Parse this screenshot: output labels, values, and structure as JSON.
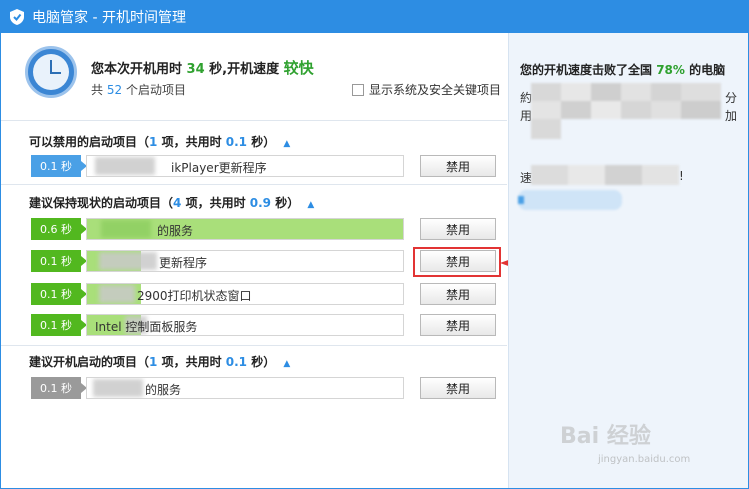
{
  "window": {
    "title": "电脑管家 - 开机时间管理"
  },
  "summary": {
    "line1_prefix": "您本次开机用时",
    "seconds": "34",
    "line1_mid": "秒,开机速度",
    "speed_word": "较快",
    "line2_prefix": "共",
    "item_count": "52",
    "line2_suffix": "个启动项目",
    "checkbox_label": "显示系统及安全关键项目"
  },
  "sections": {
    "can_disable": {
      "title": "可以禁用的启动项目（",
      "count": "1",
      "mid": "项，共用时",
      "time": "0.1",
      "suffix": "秒）"
    },
    "keep": {
      "title": "建议保持现状的启动项目（",
      "count": "4",
      "mid": "项，共用时",
      "time": "0.9",
      "suffix": "秒）"
    },
    "recommend": {
      "title": "建议开机启动的项目（",
      "count": "1",
      "mid": "项，共用时",
      "time": "0.1",
      "suffix": "秒）"
    }
  },
  "rows": [
    {
      "time": "0.1 秒",
      "name": "ikPlayer更新程序",
      "button": "禁用",
      "badge_color": "#4aa0e6",
      "bar_fraction": 0
    },
    {
      "time": "0.6 秒",
      "name": "的服务",
      "button": "禁用",
      "badge_color": "#52b81f",
      "bar_fraction": 1.0
    },
    {
      "time": "0.1 秒",
      "name": "更新程序",
      "button": "禁用",
      "badge_color": "#52b81f",
      "bar_fraction": 0.17
    },
    {
      "time": "0.1 秒",
      "name": "2900打印机状态窗口",
      "button": "禁用",
      "badge_color": "#52b81f",
      "bar_fraction": 0.17
    },
    {
      "time": "0.1 秒",
      "name": "Intel    控制面板服务",
      "button": "禁用",
      "badge_color": "#52b81f",
      "bar_fraction": 0.17
    },
    {
      "time": "0.1 秒",
      "name": "的服务",
      "button": "禁用",
      "badge_color": "#9a9a9a",
      "bar_fraction": 0
    }
  ],
  "right_panel": {
    "title_prefix": "您的开机速度击败了全国",
    "percent": "78%",
    "title_suffix": "的电脑",
    "frag_1": "約",
    "frag_2": "分",
    "frag_3": "用",
    "frag_4": "加",
    "frag_5": "速",
    "frag_6": "!"
  },
  "watermark": {
    "brand": "Bai 经验",
    "url": "jingyan.baidu.com"
  }
}
